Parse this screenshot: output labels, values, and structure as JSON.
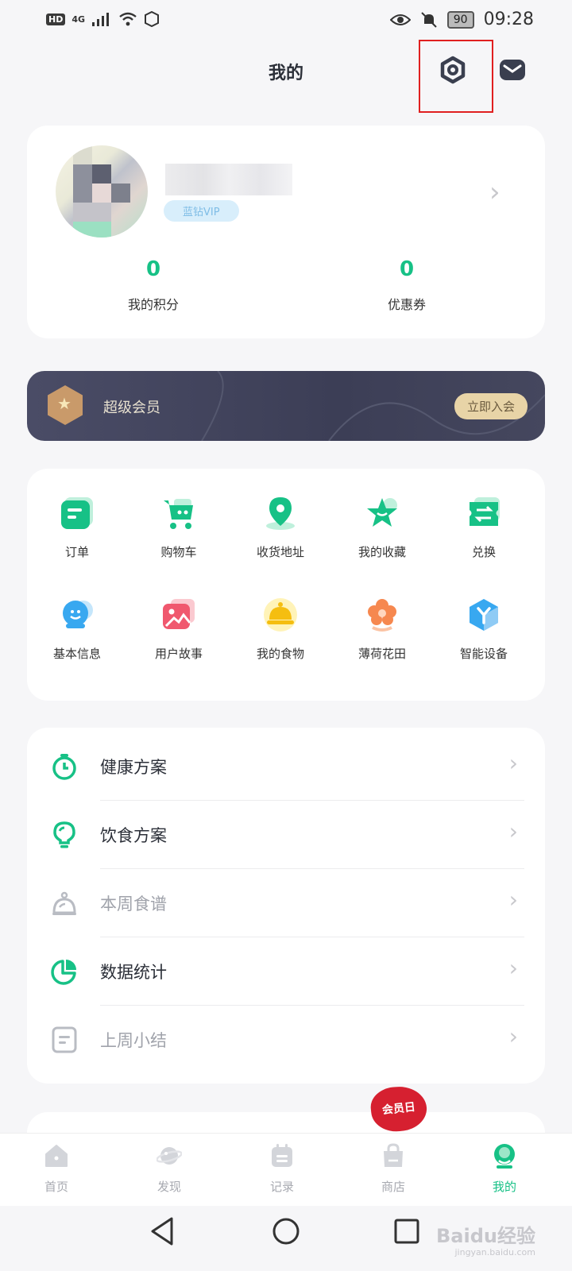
{
  "status_bar": {
    "network": "4G",
    "battery": "90",
    "time": "09:28",
    "hd_label": "HD"
  },
  "header": {
    "title": "我的",
    "icons": [
      "settings-icon",
      "mail-icon"
    ]
  },
  "profile": {
    "vip_label": "蓝钻VIP",
    "points_value": "0",
    "points_label": "我的积分",
    "coupons_value": "0",
    "coupons_label": "优惠券"
  },
  "membership": {
    "label": "超级会员",
    "join_button": "立即入会"
  },
  "grid": {
    "items": [
      {
        "label": "订单",
        "icon": "order-icon"
      },
      {
        "label": "购物车",
        "icon": "cart-icon"
      },
      {
        "label": "收货地址",
        "icon": "location-icon"
      },
      {
        "label": "我的收藏",
        "icon": "star-icon"
      },
      {
        "label": "兑换",
        "icon": "exchange-icon"
      },
      {
        "label": "基本信息",
        "icon": "profile-icon"
      },
      {
        "label": "用户故事",
        "icon": "picture-icon"
      },
      {
        "label": "我的食物",
        "icon": "cloche-icon"
      },
      {
        "label": "薄荷花田",
        "icon": "flower-icon"
      },
      {
        "label": "智能设备",
        "icon": "device-icon"
      }
    ]
  },
  "list": {
    "items": [
      {
        "label": "健康方案",
        "icon": "timer-icon"
      },
      {
        "label": "饮食方案",
        "icon": "bulb-icon"
      },
      {
        "label": "本周食谱",
        "icon": "scale-icon"
      },
      {
        "label": "数据统计",
        "icon": "pie-chart-icon"
      },
      {
        "label": "上周小结",
        "icon": "note-icon"
      }
    ]
  },
  "promo_badge": "会员日",
  "bottom_nav": {
    "items": [
      {
        "label": "首页",
        "icon": "home-icon"
      },
      {
        "label": "发现",
        "icon": "planet-icon"
      },
      {
        "label": "记录",
        "icon": "calendar-icon"
      },
      {
        "label": "商店",
        "icon": "bag-icon"
      },
      {
        "label": "我的",
        "icon": "me-icon"
      }
    ],
    "active": "我的"
  },
  "watermark": {
    "brand": "Baidu经验",
    "url": "jingyan.baidu.com"
  },
  "colors": {
    "accent": "#17c186",
    "highlight_box": "#e02020",
    "banner_bg": "#44465e",
    "banner_button": "#e8d4a7"
  }
}
